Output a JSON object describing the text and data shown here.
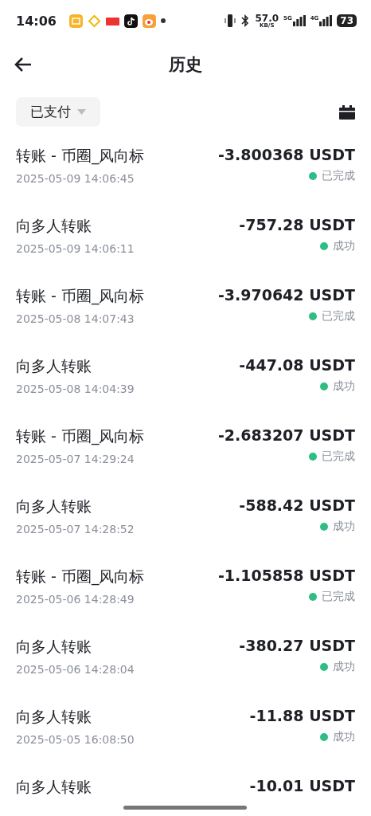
{
  "status_bar": {
    "time": "14:06",
    "net_speed": "57.0",
    "net_unit": "KB/S",
    "sim1": "5G",
    "sim2": "4G",
    "battery": "73"
  },
  "header": {
    "title": "历史"
  },
  "filter": {
    "label": "已支付"
  },
  "transactions": [
    {
      "title": "转账 - 币圈_风向标",
      "date": "2025-05-09 14:06:45",
      "amount": "-3.800368 USDT",
      "status": "已完成"
    },
    {
      "title": "向多人转账",
      "date": "2025-05-09 14:06:11",
      "amount": "-757.28 USDT",
      "status": "成功"
    },
    {
      "title": "转账 - 币圈_风向标",
      "date": "2025-05-08 14:07:43",
      "amount": "-3.970642 USDT",
      "status": "已完成"
    },
    {
      "title": "向多人转账",
      "date": "2025-05-08 14:04:39",
      "amount": "-447.08 USDT",
      "status": "成功"
    },
    {
      "title": "转账 - 币圈_风向标",
      "date": "2025-05-07 14:29:24",
      "amount": "-2.683207 USDT",
      "status": "已完成"
    },
    {
      "title": "向多人转账",
      "date": "2025-05-07 14:28:52",
      "amount": "-588.42 USDT",
      "status": "成功"
    },
    {
      "title": "转账 - 币圈_风向标",
      "date": "2025-05-06 14:28:49",
      "amount": "-1.105858 USDT",
      "status": "已完成"
    },
    {
      "title": "向多人转账",
      "date": "2025-05-06 14:28:04",
      "amount": "-380.27 USDT",
      "status": "成功"
    },
    {
      "title": "向多人转账",
      "date": "2025-05-05 16:08:50",
      "amount": "-11.88 USDT",
      "status": "成功"
    },
    {
      "title": "向多人转账",
      "amount": "-10.01 USDT"
    }
  ]
}
